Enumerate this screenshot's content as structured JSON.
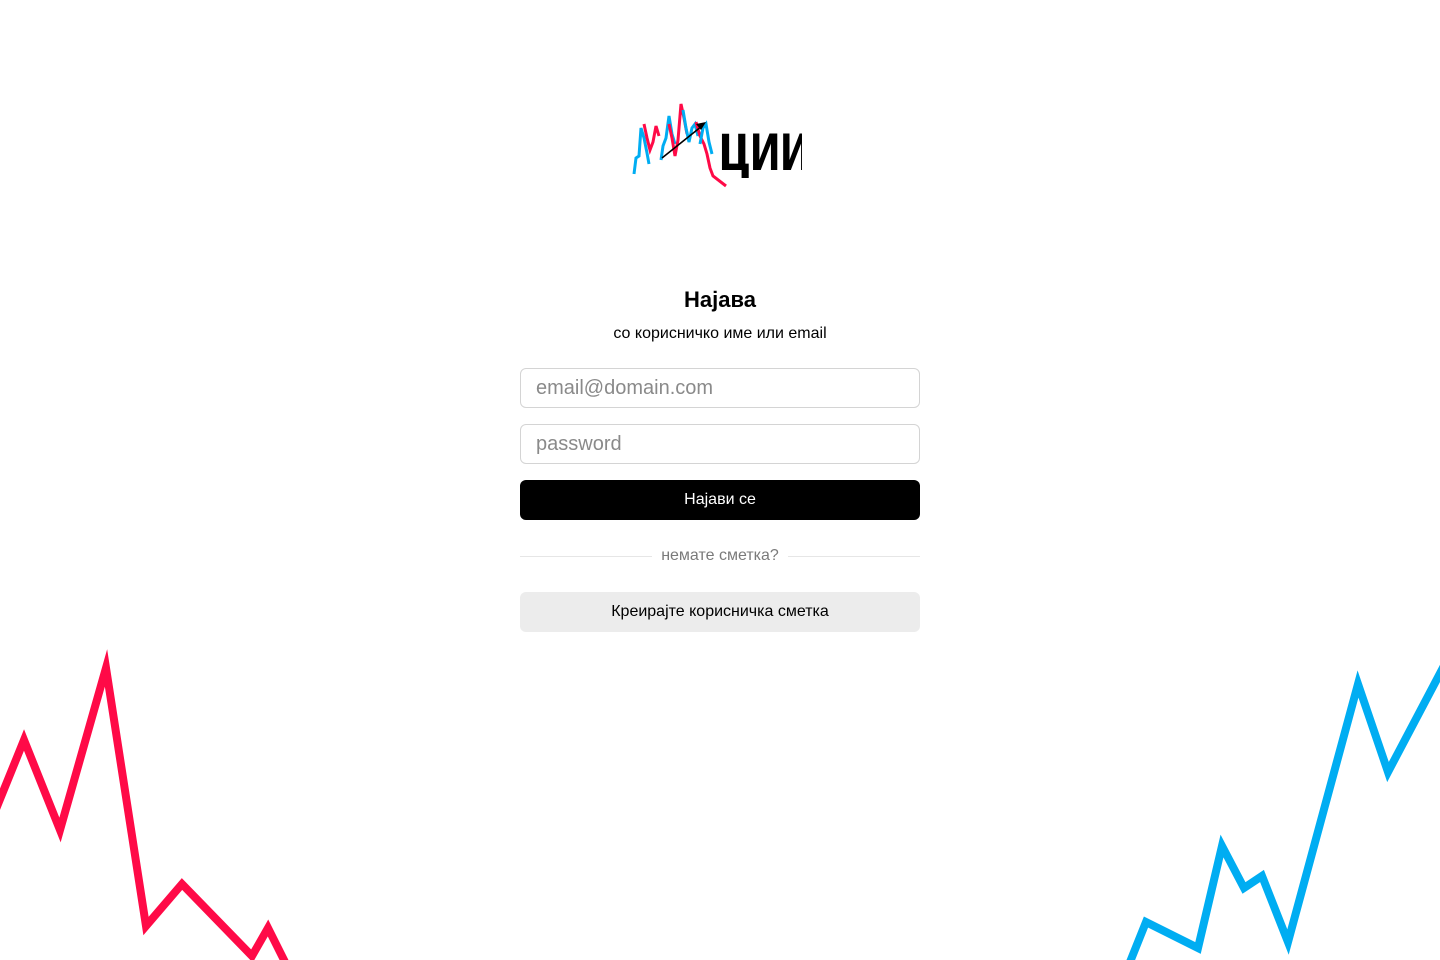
{
  "brand": {
    "logo_text": "ЦИИ",
    "accent_red": "#ff0a47",
    "accent_blue": "#00adf2"
  },
  "login": {
    "title": "Најава",
    "subtitle": "со корисничко име или email",
    "email_placeholder": "email@domain.com",
    "password_placeholder": "password",
    "submit_label": "Најави се",
    "divider_text": "немате сметка?",
    "register_label": "Креирајте корисничка сметка"
  }
}
